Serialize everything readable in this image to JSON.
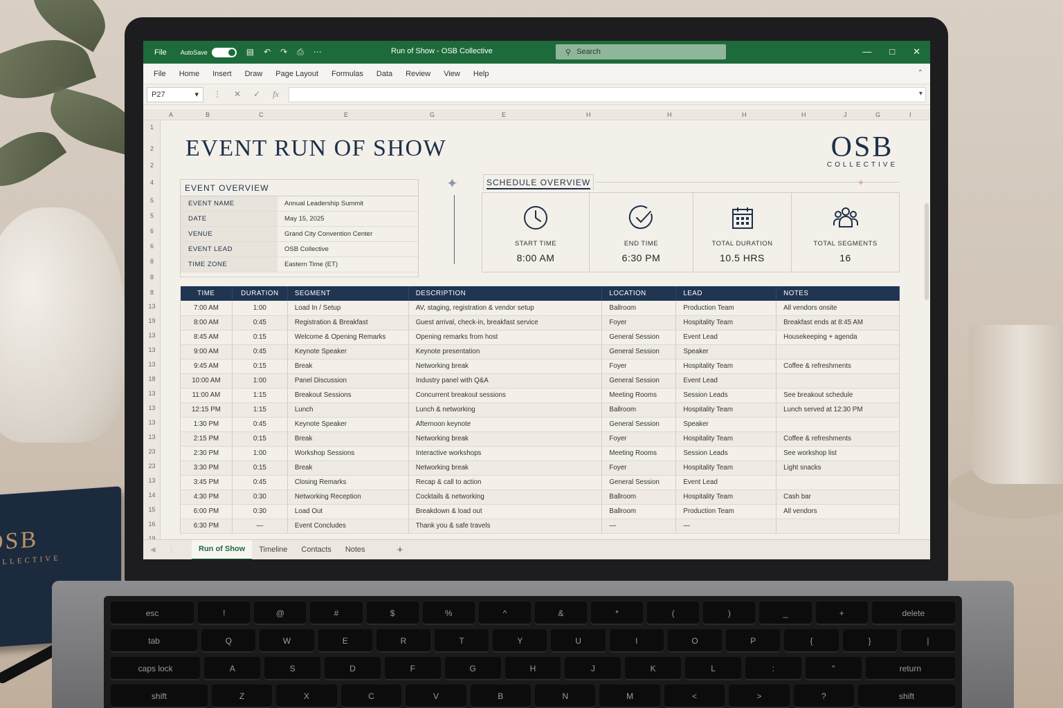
{
  "titlebar": {
    "file": "File",
    "autosave": "AutoSave",
    "title": "Run of Show - OSB Collective",
    "search_placeholder": "Search"
  },
  "menu": [
    "File",
    "Home",
    "Insert",
    "Draw",
    "Page Layout",
    "Formulas",
    "Data",
    "Review",
    "View",
    "Help"
  ],
  "formula_bar": {
    "name_box": "P27",
    "fx": "fx"
  },
  "columns": [
    "A",
    "B",
    "C",
    "E",
    "G",
    "E",
    "H",
    "H",
    "H",
    "H",
    "J",
    "G",
    "I"
  ],
  "rows": [
    "1",
    "2",
    "2",
    "4",
    "5",
    "5",
    "6",
    "6",
    "8",
    "8",
    "8",
    "13",
    "19",
    "13",
    "13",
    "13",
    "18",
    "13",
    "13",
    "13",
    "13",
    "23",
    "23",
    "13",
    "14",
    "15",
    "16",
    "19"
  ],
  "sheet": {
    "title": "EVENT RUN OF SHOW",
    "brand": {
      "name": "OSB",
      "sub": "COLLECTIVE"
    },
    "overview": {
      "title": "EVENT OVERVIEW",
      "rows": [
        {
          "label": "EVENT NAME",
          "value": "Annual Leadership Summit"
        },
        {
          "label": "DATE",
          "value": "May 15, 2025"
        },
        {
          "label": "VENUE",
          "value": "Grand City Convention Center"
        },
        {
          "label": "EVENT LEAD",
          "value": "OSB Collective"
        },
        {
          "label": "TIME ZONE",
          "value": "Eastern Time (ET)"
        }
      ]
    },
    "schedule_overview": {
      "title": "SCHEDULE OVERVIEW",
      "cards": [
        {
          "icon": "clock-icon",
          "label": "START TIME",
          "value": "8:00 AM"
        },
        {
          "icon": "check-clock-icon",
          "label": "END TIME",
          "value": "6:30 PM"
        },
        {
          "icon": "calendar-icon",
          "label": "TOTAL DURATION",
          "value": "10.5 HRS"
        },
        {
          "icon": "people-icon",
          "label": "TOTAL SEGMENTS",
          "value": "16"
        }
      ]
    },
    "table": {
      "headers": [
        "TIME",
        "DURATION",
        "SEGMENT",
        "DESCRIPTION",
        "LOCATION",
        "LEAD",
        "NOTES"
      ],
      "rows": [
        [
          "7:00 AM",
          "1:00",
          "Load In / Setup",
          "AV, staging, registration & vendor setup",
          "Ballroom",
          "Production Team",
          "All vendors onsite"
        ],
        [
          "8:00 AM",
          "0:45",
          "Registration & Breakfast",
          "Guest arrival, check-in, breakfast service",
          "Foyer",
          "Hospitality Team",
          "Breakfast ends at 8:45 AM"
        ],
        [
          "8:45 AM",
          "0:15",
          "Welcome & Opening Remarks",
          "Opening remarks from host",
          "General Session",
          "Event Lead",
          "Housekeeping + agenda"
        ],
        [
          "9:00 AM",
          "0:45",
          "Keynote Speaker",
          "Keynote presentation",
          "General Session",
          "Speaker",
          ""
        ],
        [
          "9:45 AM",
          "0:15",
          "Break",
          "Networking break",
          "Foyer",
          "Hospitality Team",
          "Coffee & refreshments"
        ],
        [
          "10:00 AM",
          "1:00",
          "Panel Discussion",
          "Industry panel with Q&A",
          "General Session",
          "Event Lead",
          ""
        ],
        [
          "11:00 AM",
          "1:15",
          "Breakout Sessions",
          "Concurrent breakout sessions",
          "Meeting Rooms",
          "Session Leads",
          "See breakout schedule"
        ],
        [
          "12:15 PM",
          "1:15",
          "Lunch",
          "Lunch & networking",
          "Ballroom",
          "Hospitality Team",
          "Lunch served at 12:30 PM"
        ],
        [
          "1:30 PM",
          "0:45",
          "Keynote Speaker",
          "Afternoon keynote",
          "General Session",
          "Speaker",
          ""
        ],
        [
          "2:15 PM",
          "0:15",
          "Break",
          "Networking break",
          "Foyer",
          "Hospitality Team",
          "Coffee & refreshments"
        ],
        [
          "2:30 PM",
          "1:00",
          "Workshop Sessions",
          "Interactive workshops",
          "Meeting Rooms",
          "Session Leads",
          "See workshop list"
        ],
        [
          "3:30 PM",
          "0:15",
          "Break",
          "Networking break",
          "Foyer",
          "Hospitality Team",
          "Light snacks"
        ],
        [
          "3:45 PM",
          "0:45",
          "Closing Remarks",
          "Recap & call to action",
          "General Session",
          "Event Lead",
          ""
        ],
        [
          "4:30 PM",
          "0:30",
          "Networking Reception",
          "Cocktails & networking",
          "Ballroom",
          "Hospitality Team",
          "Cash bar"
        ],
        [
          "6:00 PM",
          "0:30",
          "Load Out",
          "Breakdown & load out",
          "Ballroom",
          "Production Team",
          "All vendors"
        ],
        [
          "6:30 PM",
          "—",
          "Event Concludes",
          "Thank you & safe travels",
          "—",
          "—",
          ""
        ]
      ]
    }
  },
  "sheet_tabs": [
    "Run of Show",
    "Timeline",
    "Contacts",
    "Notes"
  ],
  "notebook": {
    "name": "OSB",
    "sub": "COLLECTIVE"
  },
  "keyboard": [
    [
      "esc",
      "!",
      "@",
      "#",
      "$",
      "%",
      "^",
      "&",
      "*",
      "(",
      ")",
      "_",
      "+",
      "delete"
    ],
    [
      "tab",
      "Q",
      "W",
      "E",
      "R",
      "T",
      "Y",
      "U",
      "I",
      "O",
      "P",
      "{",
      "}",
      "|"
    ],
    [
      "caps lock",
      "A",
      "S",
      "D",
      "F",
      "G",
      "H",
      "J",
      "K",
      "L",
      ":",
      "\"",
      "return"
    ],
    [
      "shift",
      "Z",
      "X",
      "C",
      "V",
      "B",
      "N",
      "M",
      "<",
      ">",
      "?",
      "shift"
    ]
  ]
}
